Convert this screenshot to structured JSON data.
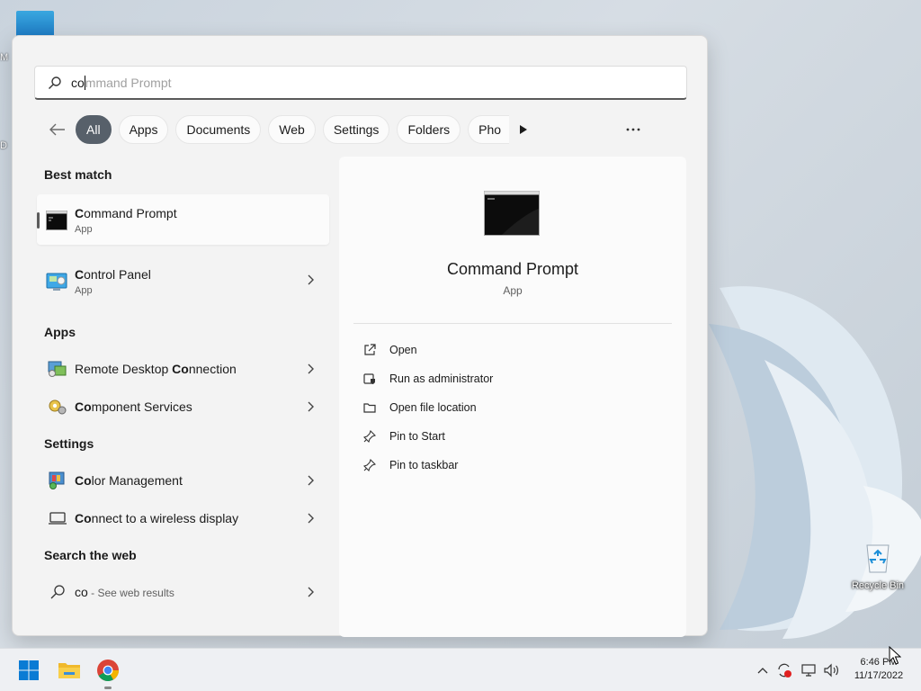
{
  "search": {
    "typed": "co",
    "autocomplete_ghost": "mmand Prompt"
  },
  "filters": {
    "items": [
      "All",
      "Apps",
      "Documents",
      "Web",
      "Settings",
      "Folders",
      "Pho"
    ],
    "active": "All"
  },
  "best_match": {
    "heading": "Best match",
    "items": [
      {
        "match": "C",
        "rest": "ommand Prompt",
        "sub": "App",
        "icon": "command-prompt-icon"
      },
      {
        "match": "C",
        "rest": "ontrol Panel",
        "sub": "App",
        "icon": "control-panel-icon"
      }
    ]
  },
  "apps": {
    "heading": "Apps",
    "items": [
      {
        "pre": "Remote Desktop ",
        "match": "Co",
        "rest": "nnection",
        "icon": "remote-desktop-icon"
      },
      {
        "pre": "",
        "match": "Co",
        "rest": "mponent Services",
        "icon": "component-services-icon"
      }
    ]
  },
  "settings": {
    "heading": "Settings",
    "items": [
      {
        "pre": "",
        "match": "Co",
        "rest": "lor Management",
        "icon": "color-management-icon"
      },
      {
        "pre": "",
        "match": "Co",
        "rest": "nnect to a wireless display",
        "icon": "wireless-display-icon"
      }
    ]
  },
  "web": {
    "heading": "Search the web",
    "query": "co",
    "suffix": " - See web results"
  },
  "preview": {
    "title": "Command Prompt",
    "subtitle": "App",
    "actions": [
      {
        "label": "Open",
        "icon": "open-icon"
      },
      {
        "label": "Run as administrator",
        "icon": "shield-admin-icon"
      },
      {
        "label": "Open file location",
        "icon": "folder-icon"
      },
      {
        "label": "Pin to Start",
        "icon": "pin-icon"
      },
      {
        "label": "Pin to taskbar",
        "icon": "pin-icon"
      }
    ]
  },
  "desktop": {
    "recycle_bin_label": "Recycle Bin"
  },
  "taskbar": {
    "time": "6:46 PM",
    "date": "11/17/2022"
  },
  "colors": {
    "accent": "#57606a",
    "start_blue": "#0078d4"
  }
}
